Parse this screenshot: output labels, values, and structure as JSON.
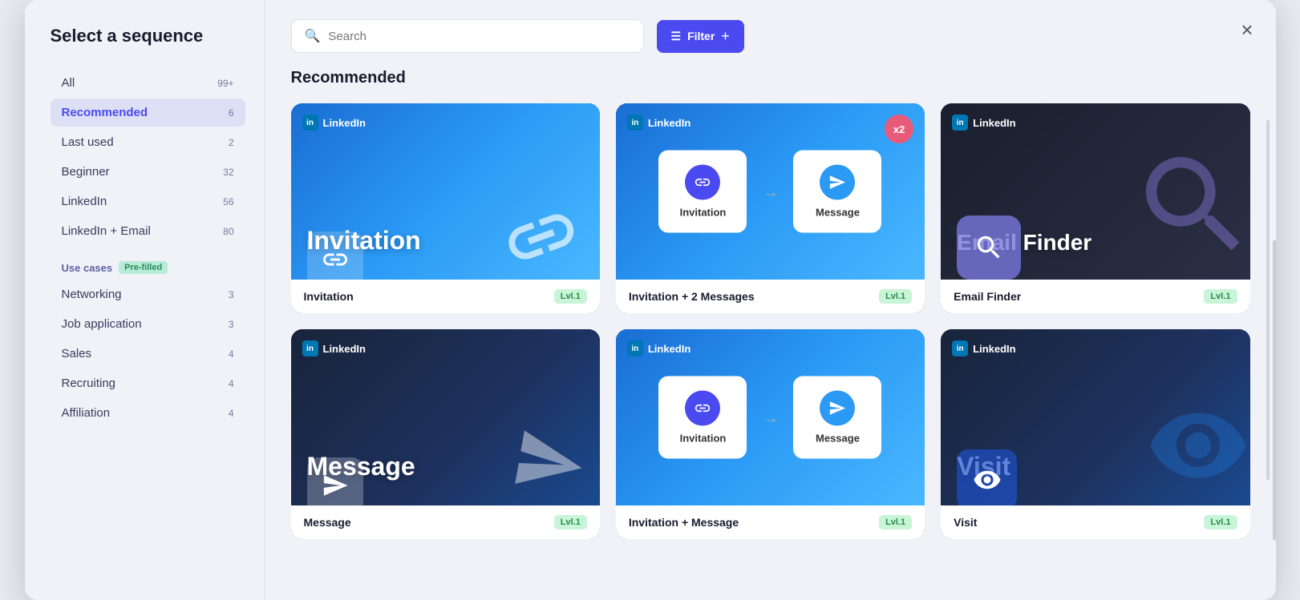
{
  "modal": {
    "title": "Select a sequence",
    "close_label": "×"
  },
  "sidebar": {
    "items": [
      {
        "label": "All",
        "count": "99+",
        "active": false,
        "id": "all"
      },
      {
        "label": "Recommended",
        "count": "6",
        "active": true,
        "id": "recommended"
      },
      {
        "label": "Last used",
        "count": "2",
        "active": false,
        "id": "last-used"
      },
      {
        "label": "Beginner",
        "count": "32",
        "active": false,
        "id": "beginner"
      },
      {
        "label": "LinkedIn",
        "count": "56",
        "active": false,
        "id": "linkedin"
      },
      {
        "label": "LinkedIn + Email",
        "count": "80",
        "active": false,
        "id": "linkedin-email"
      }
    ],
    "use_cases_label": "Use cases",
    "prefilled_label": "Pre-filled",
    "use_case_items": [
      {
        "label": "Networking",
        "count": "3"
      },
      {
        "label": "Job application",
        "count": "3"
      },
      {
        "label": "Sales",
        "count": "4"
      },
      {
        "label": "Recruiting",
        "count": "4"
      },
      {
        "label": "Affiliation",
        "count": "4"
      }
    ]
  },
  "main": {
    "search_placeholder": "Search",
    "filter_label": "Filter",
    "section_title": "Recommended",
    "cards": [
      {
        "id": "invitation",
        "label": "Invitation",
        "level": "Lvl.1",
        "type": "single",
        "style": "blue",
        "big_text": "Invitation",
        "platform": "LinkedIn"
      },
      {
        "id": "invitation-2msg",
        "label": "Invitation + 2 Messages",
        "level": "Lvl.1",
        "type": "two-step",
        "style": "blue",
        "step1": "Invitation",
        "step2": "Message",
        "x2": "x2",
        "platform": "LinkedIn"
      },
      {
        "id": "email-finder",
        "label": "Email Finder",
        "level": "Lvl.1",
        "type": "single",
        "style": "dark",
        "big_text": "Email Finder",
        "platform": "LinkedIn"
      },
      {
        "id": "message",
        "label": "Message",
        "level": "Lvl.1",
        "type": "single",
        "style": "dark-blue",
        "big_text": "Message",
        "platform": "LinkedIn"
      },
      {
        "id": "invitation-msg",
        "label": "Invitation + Message",
        "level": "Lvl.1",
        "type": "two-step",
        "style": "blue",
        "step1": "Invitation",
        "step2": "Message",
        "platform": "LinkedIn"
      },
      {
        "id": "visit",
        "label": "Visit",
        "level": "Lvl.1",
        "type": "single",
        "style": "dark",
        "big_text": "Visit",
        "platform": "LinkedIn"
      }
    ]
  }
}
